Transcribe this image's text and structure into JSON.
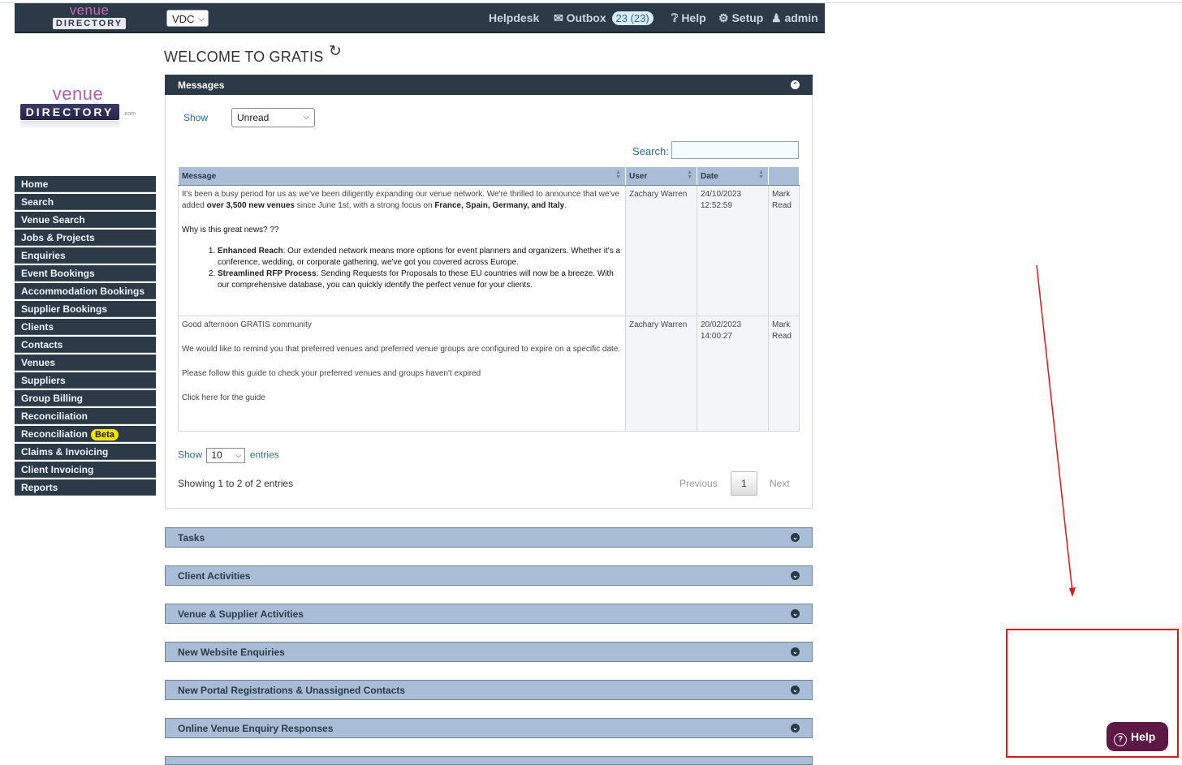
{
  "topbar": {
    "logo_top": "venue",
    "logo_bottom": "DIRECTORY",
    "account_select": "VDC",
    "helpdesk": "Helpdesk",
    "outbox": "Outbox",
    "outbox_badge": "23 (23)",
    "help": "Help",
    "setup": "Setup",
    "user": "admin"
  },
  "page": {
    "title": "WELCOME TO GRATIS"
  },
  "logo": {
    "top": "venue",
    "bottom": "DIRECTORY",
    "suffix": ".com"
  },
  "sidebar": {
    "items": [
      {
        "label": "Home"
      },
      {
        "label": "Search"
      },
      {
        "label": "Venue Search"
      },
      {
        "label": "Jobs & Projects"
      },
      {
        "label": "Enquiries"
      },
      {
        "label": "Event Bookings"
      },
      {
        "label": "Accommodation Bookings"
      },
      {
        "label": "Supplier Bookings"
      },
      {
        "label": "Clients"
      },
      {
        "label": "Contacts"
      },
      {
        "label": "Venues"
      },
      {
        "label": "Suppliers"
      },
      {
        "label": "Group Billing"
      },
      {
        "label": "Reconciliation"
      },
      {
        "label": "Reconciliation",
        "badge": "Beta"
      },
      {
        "label": "Claims & Invoicing"
      },
      {
        "label": "Client Invoicing"
      },
      {
        "label": "Reports"
      }
    ]
  },
  "messages": {
    "heading": "Messages",
    "show_label": "Show",
    "show_value": "Unread",
    "search_label": "Search:",
    "columns": [
      "Message",
      "User",
      "Date",
      ""
    ],
    "rows": [
      {
        "intro_a": "It's been a busy period for us as we've been diligently expanding our venue network. We're thrilled to announce that we've added ",
        "intro_b": "over 3,500 new venues",
        "intro_c": " since June 1st, with a strong focus on ",
        "intro_d": "France, Spain, Germany, and Italy",
        "intro_e": ".",
        "subhead": "Why is this great news? ??",
        "point1_title": "Enhanced Reach",
        "point1_text": ": Our extended network means more options for event planners and organizers. Whether it's a conference, wedding, or corporate gathering, we've got you covered across Europe.",
        "point2_title": "Streamlined RFP Process",
        "point2_text": ": Sending Requests for Proposals to these EU countries will now be a breeze. With our comprehensive database, you can quickly identify the perfect venue for your clients.",
        "user": "Zachary Warren",
        "date": "24/10/2023",
        "time": "12:52:59",
        "action1": "Mark",
        "action2": "Read"
      },
      {
        "line1": "Good afternoon GRATIS community",
        "line2": "We would like to remind you that preferred venues and preferred venue groups are configured to expire on a specific date.",
        "line3": "Please follow this guide to check your preferred venues and groups haven't expired",
        "line4": "Click here for the guide",
        "user": "Zachary Warren",
        "date": "20/02/2023",
        "time": "14:00:27",
        "action1": "Mark",
        "action2": "Read"
      }
    ],
    "show_entries_label": "Show",
    "entries_value": "10",
    "entries_label": "entries",
    "showing": "Showing 1 to 2 of 2 entries",
    "previous": "Previous",
    "page": "1",
    "next": "Next"
  },
  "panels": [
    {
      "label": "Tasks"
    },
    {
      "label": "Client Activities"
    },
    {
      "label": "Venue & Supplier Activities"
    },
    {
      "label": "New Website Enquiries"
    },
    {
      "label": "New Portal Registrations & Unassigned Contacts"
    },
    {
      "label": "Online Venue Enquiry Responses"
    }
  ],
  "help_widget": {
    "label": "Help"
  },
  "colors": {
    "navy": "#2c3a48",
    "light_blue": "#a9bdd6",
    "annotation_red": "#d9191e",
    "help_purple": "#5d1846"
  }
}
